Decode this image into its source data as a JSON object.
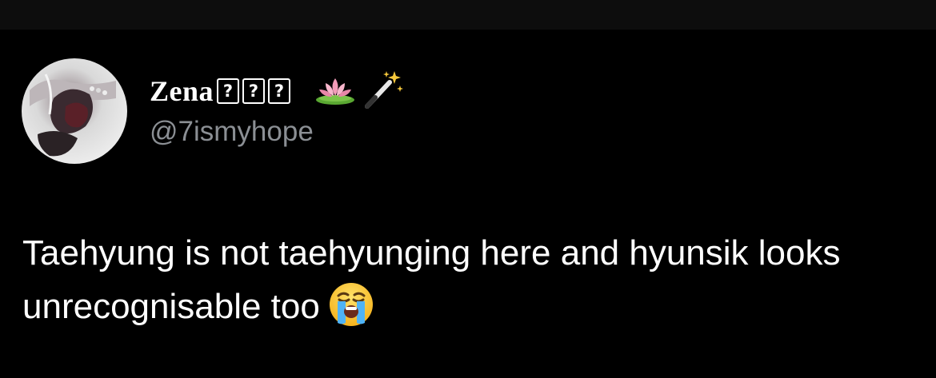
{
  "user": {
    "display_name": "Zena",
    "name_placeholders": [
      "?",
      "?",
      "?"
    ],
    "name_emojis": [
      "lotus-icon",
      "magic-wand-icon"
    ],
    "handle": "@7ismyhope"
  },
  "tweet": {
    "text": "Taehyung is not taehyunging here and hyunsik looks unrecognisable too",
    "trailing_emoji": "loudly-crying-face-icon"
  },
  "colors": {
    "background": "#000000",
    "top_bar": "#0d0d0d",
    "text_primary": "#ffffff",
    "text_secondary": "#8b8f94"
  }
}
